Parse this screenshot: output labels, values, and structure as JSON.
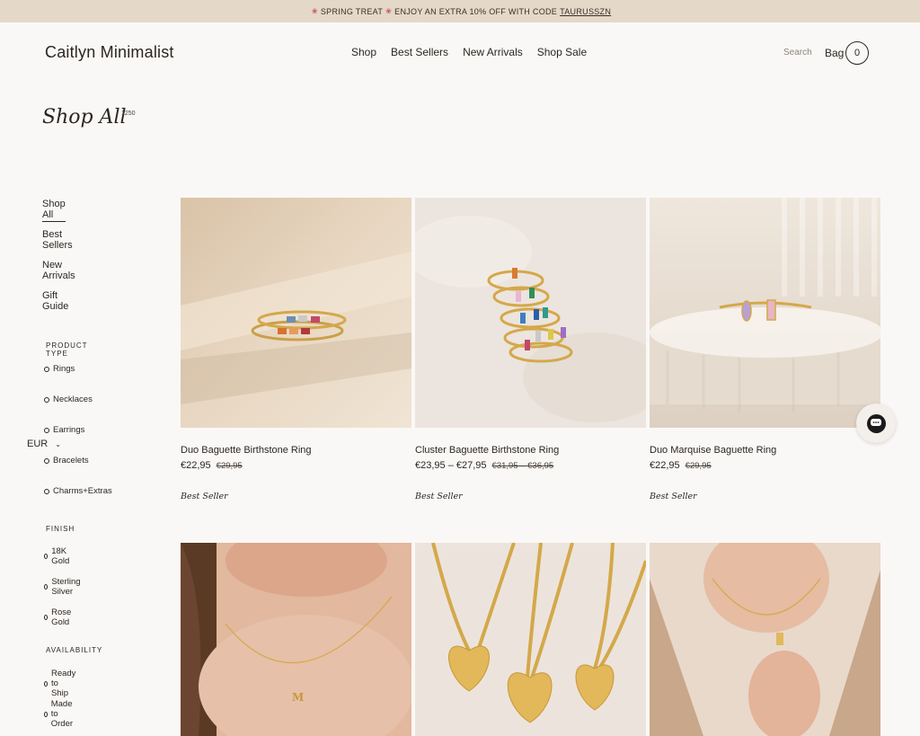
{
  "promo": {
    "text": "SPRING TREAT",
    "text2": "ENJOY AN EXTRA 10% OFF WITH CODE",
    "code": "TAURUSSZN"
  },
  "header": {
    "logo": "Caitlyn Minimalist",
    "nav": [
      "Shop",
      "Best Sellers",
      "New Arrivals",
      "Shop Sale"
    ],
    "search": "Search",
    "bag": "Bag",
    "bag_count": "0"
  },
  "page": {
    "title": "Shop All",
    "count": "1250"
  },
  "sidebar": {
    "links": [
      "Shop All",
      "Best Sellers",
      "New Arrivals",
      "Gift Guide"
    ],
    "product_type": {
      "heading": "PRODUCT TYPE",
      "items": [
        "Rings",
        "Necklaces",
        "Earrings",
        "Bracelets",
        "Charms+Extras"
      ]
    },
    "finish": {
      "heading": "FINISH",
      "items": [
        "18K Gold",
        "Sterling Silver",
        "Rose Gold"
      ]
    },
    "availability": {
      "heading": "AVAILABILITY",
      "items": [
        "Ready to Ship",
        "Made to Order"
      ]
    }
  },
  "currency": "EUR",
  "products": [
    {
      "name": "Duo Baguette Birthstone Ring",
      "price": "€22,95",
      "old_price": "€29,95",
      "badge": "Best Seller"
    },
    {
      "name": "Cluster Baguette Birthstone Ring",
      "price": "€23,95 – €27,95",
      "old_price": "€31,95 – €36,95",
      "badge": "Best Seller"
    },
    {
      "name": "Duo Marquise Baguette Ring",
      "price": "€22,95",
      "old_price": "€29,95",
      "badge": "Best Seller"
    }
  ],
  "icons": {
    "chat": "chat-bubble-icon",
    "chevron": "chevron-down-icon",
    "flower": "tulip-icon"
  },
  "colors": {
    "promo_bg": "#e4d8c8",
    "page_bg": "#faf8f6",
    "text": "#2b2622",
    "gold": "#d4a84a"
  }
}
